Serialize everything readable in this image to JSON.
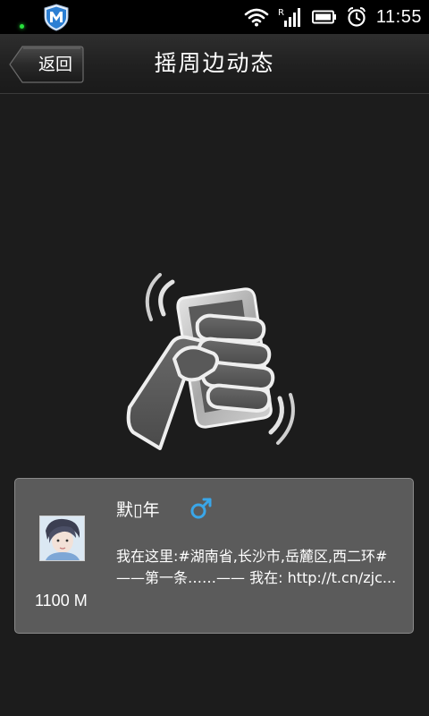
{
  "status_bar": {
    "time": "11:55",
    "icons": [
      "notification-dot",
      "shield-m-icon",
      "wifi-icon",
      "signal-icon",
      "battery-icon",
      "alarm-icon"
    ]
  },
  "header": {
    "back_label": "返回",
    "title": "摇周边动态"
  },
  "illustration": {
    "icon": "shake-phone-icon"
  },
  "result": {
    "nickname": "默▯年",
    "gender": "male",
    "gender_symbol": "♂",
    "gender_color": "#3aa6e8",
    "distance": "1100 M",
    "status_text": "我在这里:#湖南省,长沙市,岳麓区,西二环#——第一条……—— 我在: http://t.cn/zjc..."
  },
  "colors": {
    "background": "#1c1c1c",
    "card": "#5b5b5b",
    "accent_green": "#27e03c"
  }
}
